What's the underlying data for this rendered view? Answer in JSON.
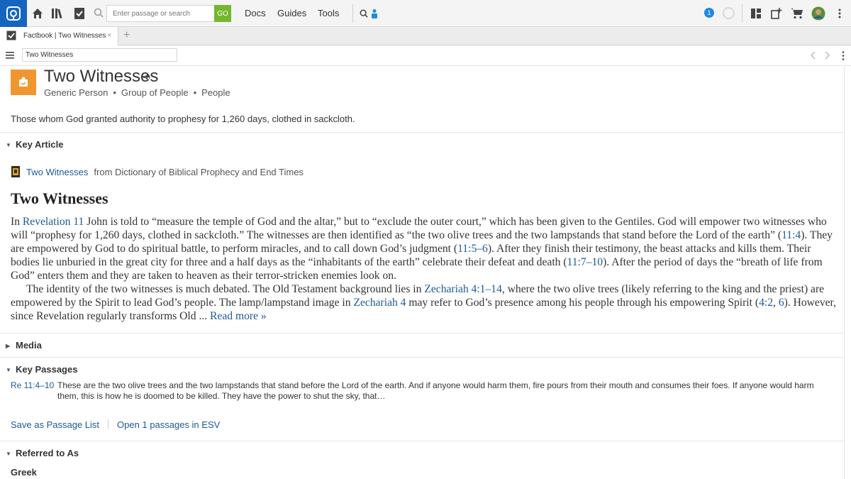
{
  "toolbar": {
    "search_placeholder": "Enter passage or search",
    "go_label": "GO",
    "menu": [
      "Docs",
      "Guides",
      "Tools"
    ],
    "notification_count": "1"
  },
  "tabs": [
    {
      "label": "Factbook | Two Witnesses",
      "close": "×"
    }
  ],
  "add_tab": "+",
  "panel": {
    "input_value": "Two Witnesses"
  },
  "entity": {
    "title": "Two Witnesses",
    "types": [
      "Generic Person",
      "Group of People",
      "People"
    ],
    "summary": "Those whom God granted authority to prophesy for 1,260 days, clothed in sackcloth."
  },
  "key_article": {
    "heading": "Key Article",
    "link": "Two Witnesses",
    "source": "from Dictionary of Biblical Prophecy and End Times",
    "title": "Two Witnesses",
    "p1": [
      {
        "t": "In "
      },
      {
        "t": "Revelation 11",
        "link": true
      },
      {
        "t": " John is told to “measure the temple of God and the altar,” but to “exclude the outer court,” which has been given to the Gentiles. God will empower two witnesses who will “prophesy for 1,260 days, clothed in sackcloth.” The witnesses are then identified as “the two olive trees and the two lampstands that stand before the Lord of the earth” ("
      },
      {
        "t": "11:4",
        "link": true
      },
      {
        "t": "). They are empowered by God to do spiritual battle, to perform miracles, and to call down God’s judgment ("
      },
      {
        "t": "11:5–6",
        "link": true
      },
      {
        "t": "). After they finish their testimony, the beast attacks and kills them. Their bodies lie unburied in the great city for three and a half days as the “inhabitants of the earth” celebrate their defeat and death ("
      },
      {
        "t": "11:7–10",
        "link": true
      },
      {
        "t": "). After the period of days the “breath of life from God” enters them and they are taken to heaven as their terror-stricken enemies look on."
      }
    ],
    "p2": [
      {
        "t": "The identity of the two witnesses is much debated. The Old Testament background lies in "
      },
      {
        "t": "Zechariah 4:1–14",
        "link": true
      },
      {
        "t": ", where the two olive trees (likely referring to the king and the priest) are empowered by the Spirit to lead God’s people. The lamp/lampstand image in "
      },
      {
        "t": "Zechariah 4",
        "link": true
      },
      {
        "t": " may refer to God’s presence among his people through his empowering Spirit ("
      },
      {
        "t": "4:2",
        "link": true
      },
      {
        "t": ", "
      },
      {
        "t": "6",
        "link": true
      },
      {
        "t": "). However, since Revelation regularly transforms Old ... "
      },
      {
        "t": "Read more »",
        "link": true
      }
    ]
  },
  "media": {
    "heading": "Media"
  },
  "key_passages": {
    "heading": "Key Passages",
    "ref": "Re 11:4–10",
    "text": "These are the two olive trees and the two lampstands that stand before the Lord of the earth. And if anyone would harm them, fire pours from their mouth and consumes their foes. If anyone would harm them, this is how he is doomed to be killed. They have the power to shut the sky, that…",
    "save_link": "Save as Passage List",
    "open_link": "Open 1 passages in ESV"
  },
  "referred_to": {
    "heading": "Referred to As",
    "subheading": "Greek"
  },
  "colors": {
    "accent": "#1565c0",
    "go": "#74b72e",
    "entity_icon": "#f0962e",
    "link": "#1a5a96"
  }
}
